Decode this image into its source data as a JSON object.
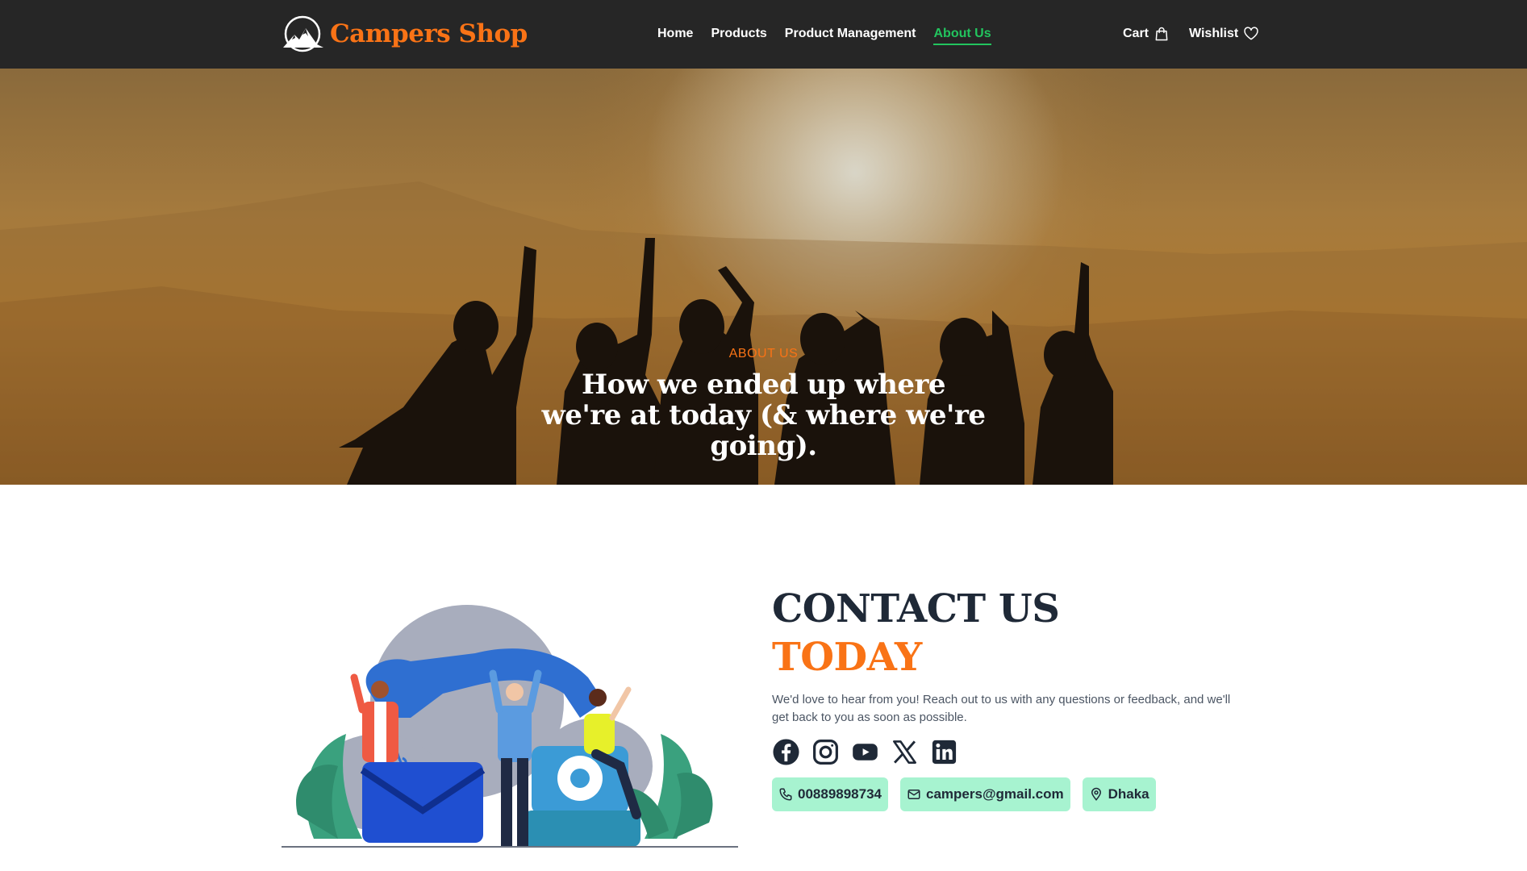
{
  "nav": {
    "brand": "Campers Shop",
    "links": [
      {
        "label": "Home"
      },
      {
        "label": "Products"
      },
      {
        "label": "Product Management"
      },
      {
        "label": "About Us",
        "active": true
      }
    ],
    "cart_label": "Cart",
    "wishlist_label": "Wishlist",
    "icons": {
      "logo": "mountain-logo-icon",
      "cart": "shopping-bag-icon",
      "wishlist": "heart-icon"
    }
  },
  "hero": {
    "eyebrow": "ABOUT US",
    "title": "How we ended up where we're at today (& where we're going)."
  },
  "contact": {
    "heading": "CONTACT US",
    "heading_accent": "TODAY",
    "description": "We'd love to hear from you! Reach out to us with any questions or feedback, and we'll get back to you as soon as possible.",
    "socials": [
      {
        "icon": "facebook-icon"
      },
      {
        "icon": "instagram-icon"
      },
      {
        "icon": "youtube-icon"
      },
      {
        "icon": "x-icon"
      },
      {
        "icon": "linkedin-icon"
      }
    ],
    "phone": "00889898734",
    "email": "campers@gmail.com",
    "location": "Dhaka"
  },
  "colors": {
    "navbar_bg": "#262626",
    "brand_orange": "#f97316",
    "active_green": "#22c55e",
    "chip_bg": "#a7f3d0",
    "heading_dark": "#1f2937"
  }
}
